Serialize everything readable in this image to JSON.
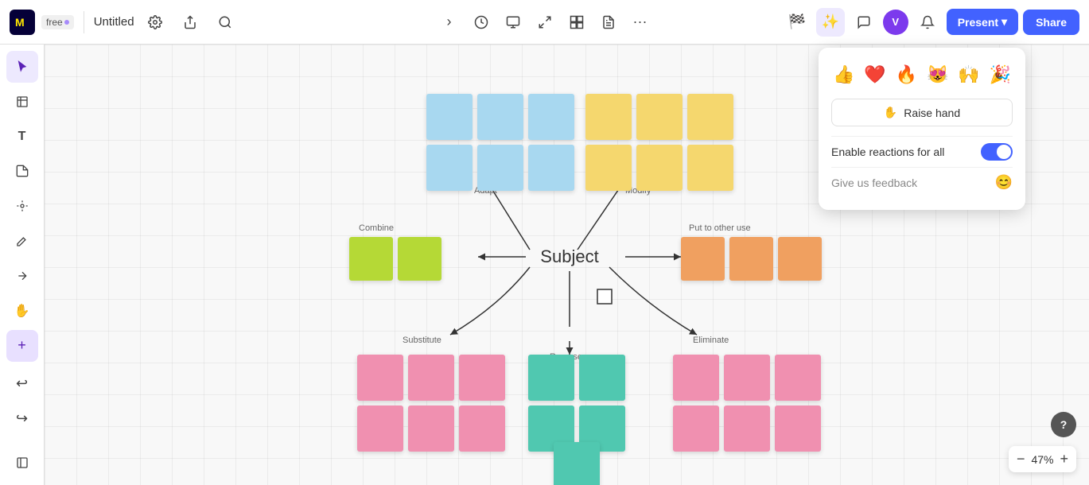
{
  "app": {
    "logo_text": "miro",
    "free_label": "free",
    "board_title": "Untitled",
    "zoom_level": "47%"
  },
  "topbar": {
    "settings_tooltip": "Settings",
    "share_tooltip": "Share",
    "search_tooltip": "Search",
    "present_label": "Present",
    "share_label": "Share",
    "avatar_initials": "V",
    "chevron_down": "▾"
  },
  "sidebar": {
    "tools": [
      "cursor",
      "table",
      "text",
      "sticky-note",
      "shape",
      "pen",
      "arrow",
      "hand",
      "plus",
      "undo",
      "redo",
      "frames"
    ]
  },
  "canvas": {
    "subject_label": "Subject",
    "labels": {
      "adapt": "Adapt",
      "modify": "Modify",
      "combine": "Combine",
      "put_to_other_use": "Put to other use",
      "substitute": "Substitute",
      "reverse": "Reverse",
      "eliminate": "Eliminate"
    }
  },
  "reactions_popup": {
    "emojis": [
      "👍",
      "❤️",
      "🔥",
      "😻",
      "🙌",
      "🎉"
    ],
    "raise_hand_label": "Raise hand",
    "raise_hand_icon": "✋",
    "enable_reactions_label": "Enable reactions for all",
    "toggle_state": true,
    "feedback_label": "Give us feedback",
    "feedback_icon": "😊"
  },
  "zoom": {
    "minus_label": "−",
    "percent": "47%",
    "plus_label": "+",
    "help_label": "?"
  }
}
